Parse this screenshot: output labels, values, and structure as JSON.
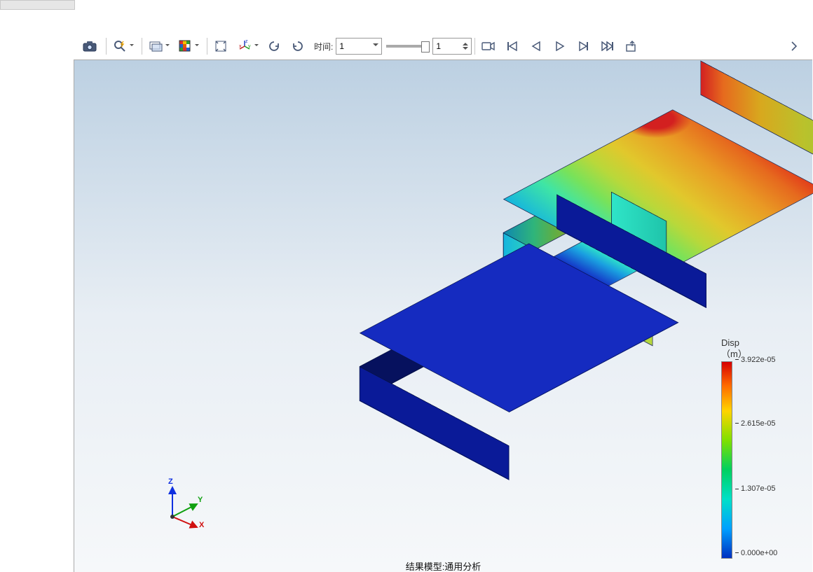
{
  "toolbar": {
    "time_label": "时间:",
    "frame_combo": "1",
    "spin_value": "1"
  },
  "viewport": {
    "caption": "结果模型:通用分析"
  },
  "triad": {
    "x": "X",
    "y": "Y",
    "z": "Z"
  },
  "legend": {
    "title_l1": "Disp",
    "title_l2": "（m）",
    "ticks": [
      {
        "p": 0,
        "v": "3.922e-05"
      },
      {
        "p": 33,
        "v": "2.615e-05"
      },
      {
        "p": 67,
        "v": "1.307e-05"
      },
      {
        "p": 100,
        "v": "0.000e+00"
      }
    ]
  },
  "chart_data": {
    "type": "colormap_legend",
    "title": "Disp（m）",
    "unit": "m",
    "min": 0.0,
    "max": 3.922e-05,
    "ticks": [
      3.922e-05,
      2.615e-05,
      1.307e-05,
      0.0
    ]
  }
}
